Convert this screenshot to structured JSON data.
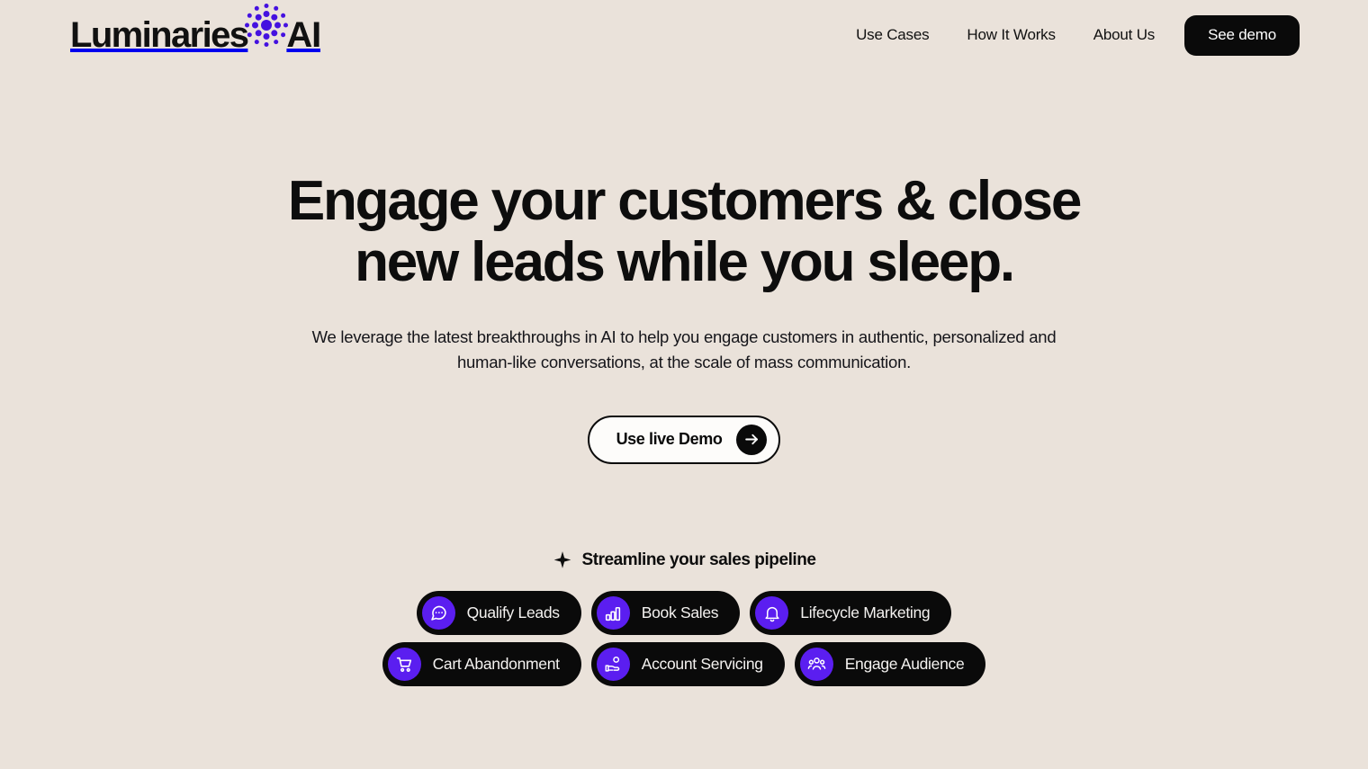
{
  "theme": {
    "background": "#eae2da",
    "accent_purple": "#5b1ef0",
    "ink": "#0a0a0a",
    "chip_text": "#f4f2f0"
  },
  "header": {
    "logo": {
      "word": "Luminaries",
      "mark": "dot-cluster-icon",
      "suffix": "AI"
    },
    "nav": [
      {
        "label": "Use Cases",
        "name": "nav-use-cases"
      },
      {
        "label": "How It Works",
        "name": "nav-how-it-works"
      },
      {
        "label": "About Us",
        "name": "nav-about-us"
      }
    ],
    "cta": {
      "label": "See demo"
    }
  },
  "hero": {
    "title": "Engage your customers & close new leads while you sleep.",
    "subtitle": "We leverage the latest breakthroughs in AI to help you engage customers in authentic, personalized and human-like conversations, at the scale of mass communication.",
    "cta": {
      "label": "Use live Demo",
      "icon": "arrow-right-icon"
    }
  },
  "pipeline": {
    "icon": "sparkle-icon",
    "title": "Streamline your sales pipeline",
    "rows": [
      [
        {
          "label": "Qualify Leads",
          "icon": "chat-bubble-icon"
        },
        {
          "label": "Book Sales",
          "icon": "bar-chart-icon"
        },
        {
          "label": "Lifecycle Marketing",
          "icon": "bell-icon"
        }
      ],
      [
        {
          "label": "Cart Abandonment",
          "icon": "shopping-cart-icon"
        },
        {
          "label": "Account Servicing",
          "icon": "hand-coin-icon"
        },
        {
          "label": "Engage Audience",
          "icon": "people-group-icon"
        }
      ]
    ]
  }
}
